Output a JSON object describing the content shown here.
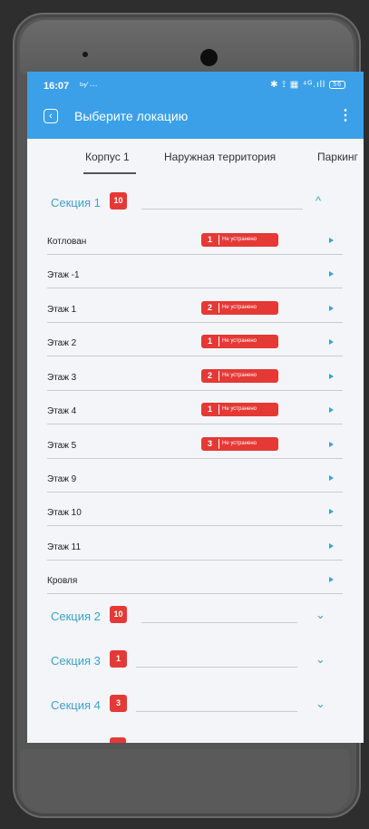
{
  "colors": {
    "accent": "#3ba0e8",
    "section_text": "#3aa3c9",
    "badge": "#e53935",
    "background": "#f4f5f9"
  },
  "status_bar": {
    "time": "16:07",
    "left_icons": "ᵇⁿ⁄ ···",
    "right_icons": "✱ ⟟ ▦ ⁴ᴳ.ıll",
    "battery": "56"
  },
  "app_bar": {
    "back_icon": "back-arrow-icon",
    "title": "Выберите локацию",
    "menu_icon": "⋮"
  },
  "tabs": [
    {
      "label": "Корпус 1",
      "active": true
    },
    {
      "label": "Наружная территория",
      "active": false
    },
    {
      "label": "Паркинг",
      "active": false
    }
  ],
  "sections": [
    {
      "name": "Секция 1",
      "count": "10",
      "expanded": true,
      "chevron": "^"
    },
    {
      "name": "Секция 2",
      "count": "10",
      "expanded": false,
      "chevron": "⌄"
    },
    {
      "name": "Секция 3",
      "count": "1",
      "expanded": false,
      "chevron": "⌄"
    },
    {
      "name": "Секция 4",
      "count": "3",
      "expanded": false,
      "chevron": "⌄"
    }
  ],
  "rows": [
    {
      "name": "Котлован",
      "count": "1",
      "status": "Не устранено"
    },
    {
      "name": "Этаж -1",
      "count": null,
      "status": null
    },
    {
      "name": "Этаж 1",
      "count": "2",
      "status": "Не устранено"
    },
    {
      "name": "Этаж 2",
      "count": "1",
      "status": "Не устранено"
    },
    {
      "name": "Этаж 3",
      "count": "2",
      "status": "Не устранено"
    },
    {
      "name": "Этаж 4",
      "count": "1",
      "status": "Не устранено"
    },
    {
      "name": "Этаж 5",
      "count": "3",
      "status": "Не устранено"
    },
    {
      "name": "Этаж 9",
      "count": null,
      "status": null
    },
    {
      "name": "Этаж 10",
      "count": null,
      "status": null
    },
    {
      "name": "Этаж 11",
      "count": null,
      "status": null
    },
    {
      "name": "Кровля",
      "count": null,
      "status": null
    }
  ]
}
